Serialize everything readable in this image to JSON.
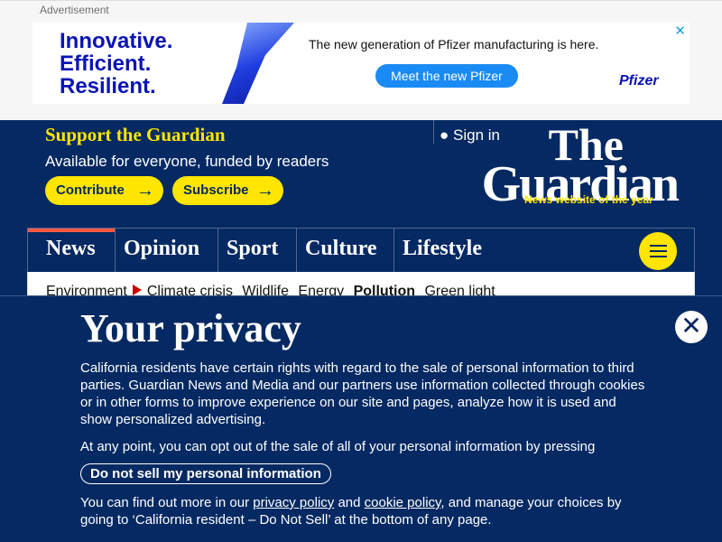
{
  "ad": {
    "label": "Advertisement",
    "headline": [
      "Innovative.",
      "Efficient.",
      "Resilient."
    ],
    "text": "The new generation of Pfizer manufacturing is here.",
    "button": "Meet the new Pfizer",
    "brand": "Pfizer",
    "close": "✕"
  },
  "header": {
    "support": "Support the Guardian",
    "subtitle": "Available for everyone, funded by readers",
    "contribute": "Contribute",
    "subscribe": "Subscribe",
    "sign_in": "Sign in",
    "logo_line1": "The",
    "logo_line2": "Guardian",
    "tagline": "News website of the year"
  },
  "nav": {
    "items": [
      "News",
      "Opinion",
      "Sport",
      "Culture",
      "Lifestyle"
    ],
    "active": "News"
  },
  "subnav": {
    "items": [
      "Environment",
      "Climate crisis",
      "Wildlife",
      "Energy",
      "Pollution",
      "Green light"
    ],
    "active": "Pollution"
  },
  "privacy": {
    "title": "Your privacy",
    "p1": "California residents have certain rights with regard to the sale of personal information to third parties. Guardian News and Media and our partners use information collected through cookies or in other forms to improve experience on our site and pages, analyze how it is used and show personalized advertising.",
    "p2": "At any point, you can opt out of the sale of all of your personal information by pressing",
    "button": "Do not sell my personal information",
    "p3a": "You can find out more in our ",
    "privacy_link": "privacy policy",
    "p3b": " and ",
    "cookie_link": "cookie policy",
    "p3c": ", and manage your choices by going to ‘California resident – Do Not Sell’ at the bottom of any page."
  }
}
